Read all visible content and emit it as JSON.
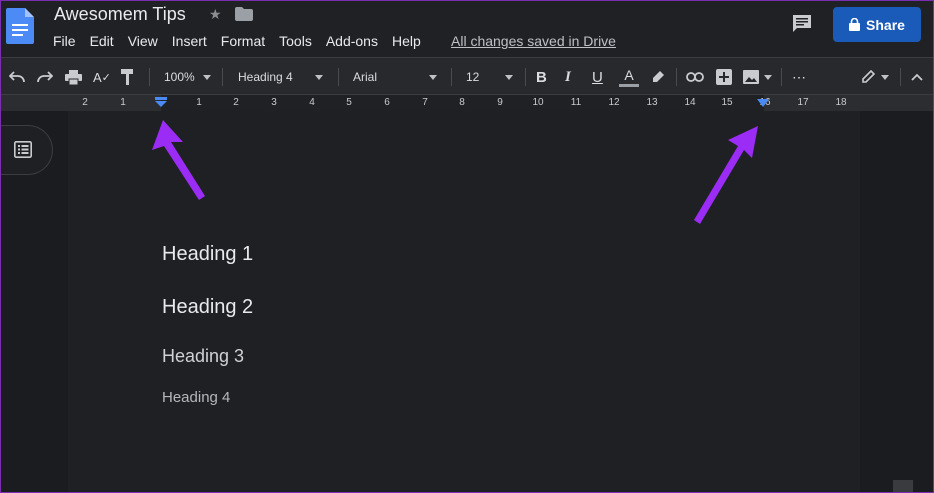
{
  "doc": {
    "title": "Awesomem Tips",
    "saved_status": "All changes saved in Drive"
  },
  "menu": [
    "File",
    "Edit",
    "View",
    "Insert",
    "Format",
    "Tools",
    "Add-ons",
    "Help"
  ],
  "share_label": "Share",
  "toolbar": {
    "zoom": "100%",
    "style": "Heading 4",
    "font": "Arial",
    "size": "12"
  },
  "ruler": {
    "numbers": [
      "2",
      "1",
      "1",
      "2",
      "3",
      "4",
      "5",
      "6",
      "7",
      "8",
      "9",
      "10",
      "11",
      "12",
      "13",
      "14",
      "15",
      "16",
      "17",
      "18"
    ]
  },
  "content": {
    "h1": "Heading 1",
    "h2": "Heading 2",
    "h3": "Heading 3",
    "h4": "Heading 4"
  },
  "colors": {
    "accent": "#1a5ab8",
    "arrow": "#9b2cf5",
    "indent_marker": "#4a8af4"
  },
  "icons": [
    "docs-icon",
    "star-icon",
    "folder-icon",
    "comment-icon",
    "lock-icon",
    "undo-icon",
    "redo-icon",
    "print-icon",
    "spellcheck-icon",
    "paint-format-icon",
    "bold-icon",
    "italic-icon",
    "underline-icon",
    "text-color-icon",
    "highlight-icon",
    "link-icon",
    "add-comment-icon",
    "image-icon",
    "more-icon",
    "edit-mode-icon",
    "collapse-icon",
    "outline-icon"
  ]
}
